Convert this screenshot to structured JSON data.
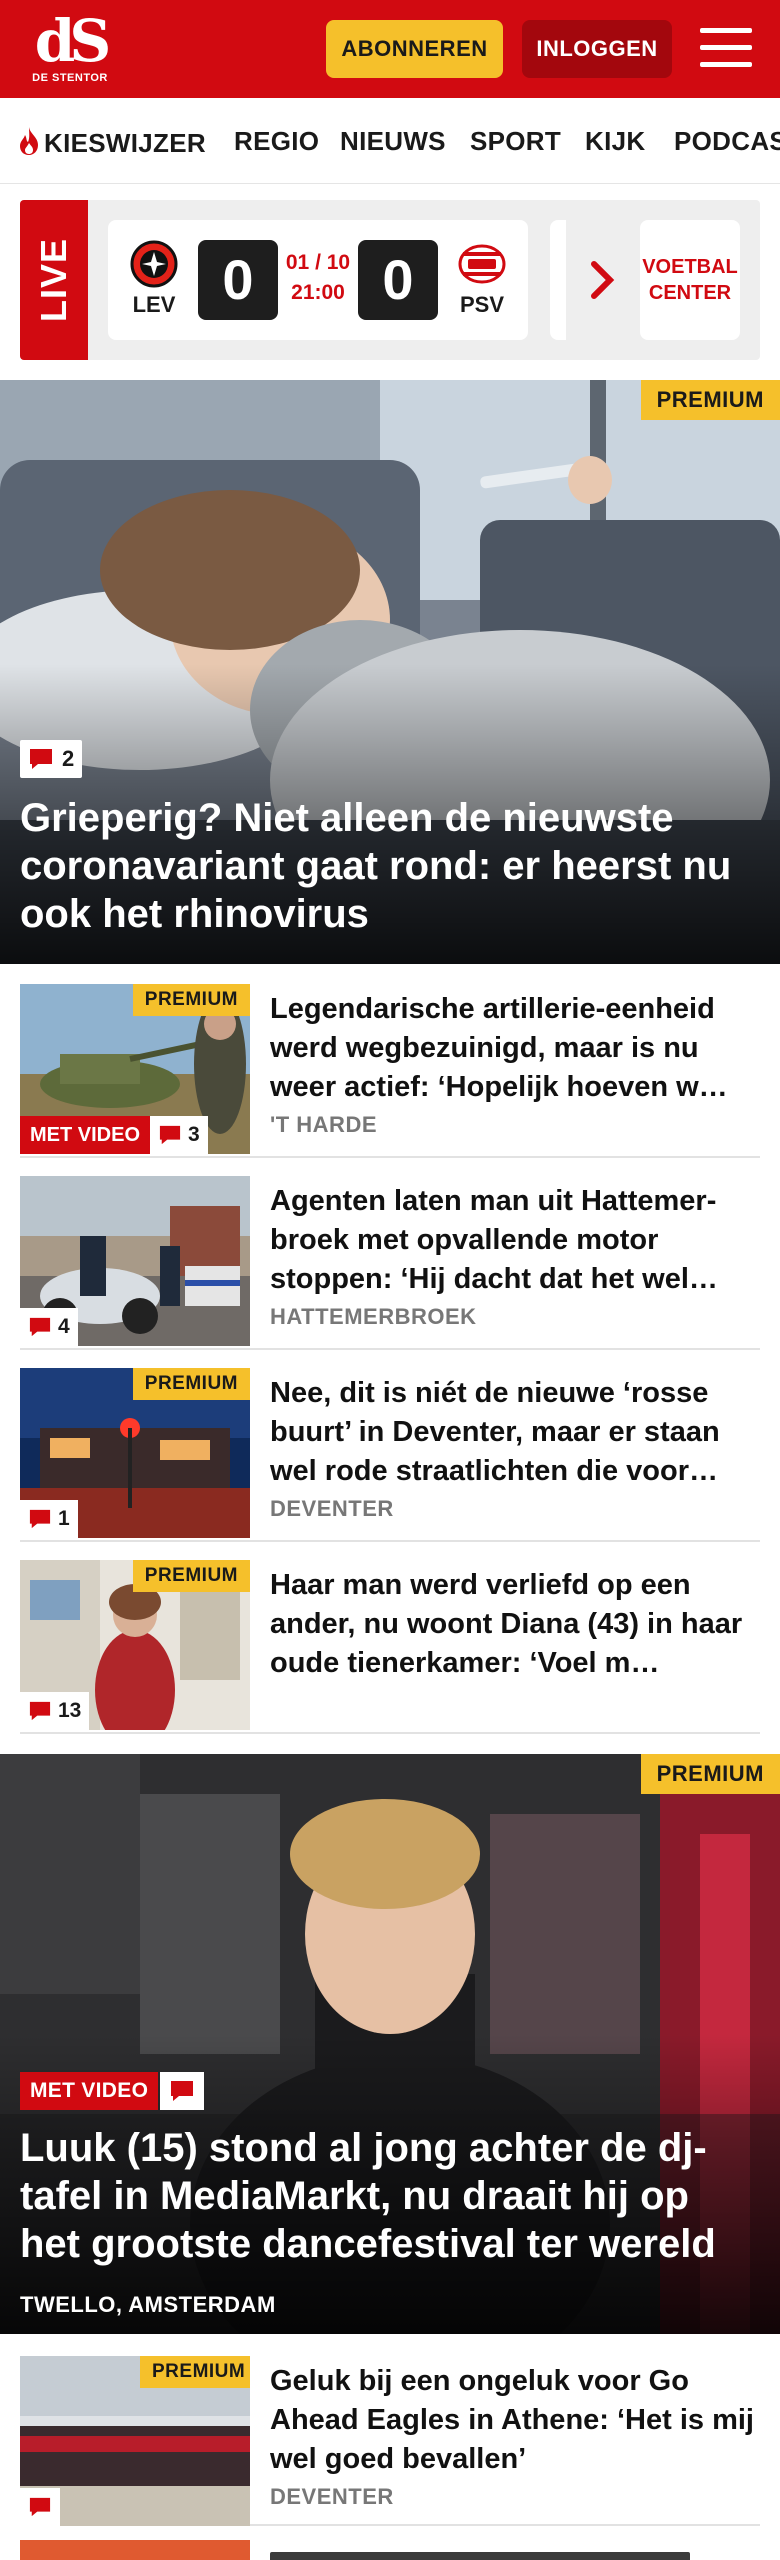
{
  "header": {
    "logo_mark": "dS",
    "logo_sub": "DE STENTOR",
    "subscribe_label": "ABONNEREN",
    "login_label": "INLOGGEN",
    "menu_icon": "hamburger-icon"
  },
  "nav": {
    "items": [
      {
        "label": "KIESWIJZER",
        "icon": "flame-icon"
      },
      {
        "label": "REGIO"
      },
      {
        "label": "NIEUWS"
      },
      {
        "label": "SPORT"
      },
      {
        "label": "KIJK"
      },
      {
        "label": "PODCAST"
      }
    ]
  },
  "live": {
    "badge": "LIVE",
    "match": {
      "home": "LEV",
      "away": "PSV",
      "home_score": "0",
      "away_score": "0",
      "date": "01 / 10",
      "time": "21:00"
    },
    "center_label_1": "VOETBAL",
    "center_label_2": "CENTER"
  },
  "hero1": {
    "premium": "PREMIUM",
    "comments": "2",
    "title": "Grieperig? Niet alleen de nieuwste coronavariant gaat rond: er heerst nu ook het rhinovirus"
  },
  "articles": [
    {
      "premium": "PREMIUM",
      "video": "MET VIDEO",
      "comments": "3",
      "title": "Legendarische artillerie-eenheid werd wegbezuinigd, maar is nu weer actief: ‘Hopelijk hoeven w…",
      "place": "'T HARDE"
    },
    {
      "premium": "",
      "video": "",
      "comments": "4",
      "title": "Agenten laten man uit Hattemer­broek met opvallende motor stoppen: ‘Hij dacht dat het wel…",
      "place": "HATTEMERBROEK"
    },
    {
      "premium": "PREMIUM",
      "video": "",
      "comments": "1",
      "title": "Nee, dit is niét de nieuwe ‘rosse buurt’ in Deventer, maar er staan wel rode straatlichten die voor…",
      "place": "DEVENTER"
    },
    {
      "premium": "PREMIUM",
      "video": "",
      "comments": "13",
      "title": "Haar man werd verliefd op een ander, nu woont Diana (43) in haar oude tienerkamer: ‘Voel m…",
      "place": ""
    }
  ],
  "hero2": {
    "premium": "PREMIUM",
    "video": "MET VIDEO",
    "title": "Luuk (15) stond al jong achter de dj-tafel in MediaMarkt, nu draait hij op het grootste dancefestival ter wereld",
    "tags": "TWELLO, AMSTERDAM"
  },
  "article_after": {
    "premium": "PREMIUM",
    "comments": "",
    "title": "Geluk bij een ongeluk voor Go Ahead Eagles in Athene: ‘Het is mij wel goed bevallen’",
    "place": "DEVENTER"
  },
  "colors": {
    "brand_red": "#d10a11",
    "premium_yellow": "#f5c02b"
  }
}
